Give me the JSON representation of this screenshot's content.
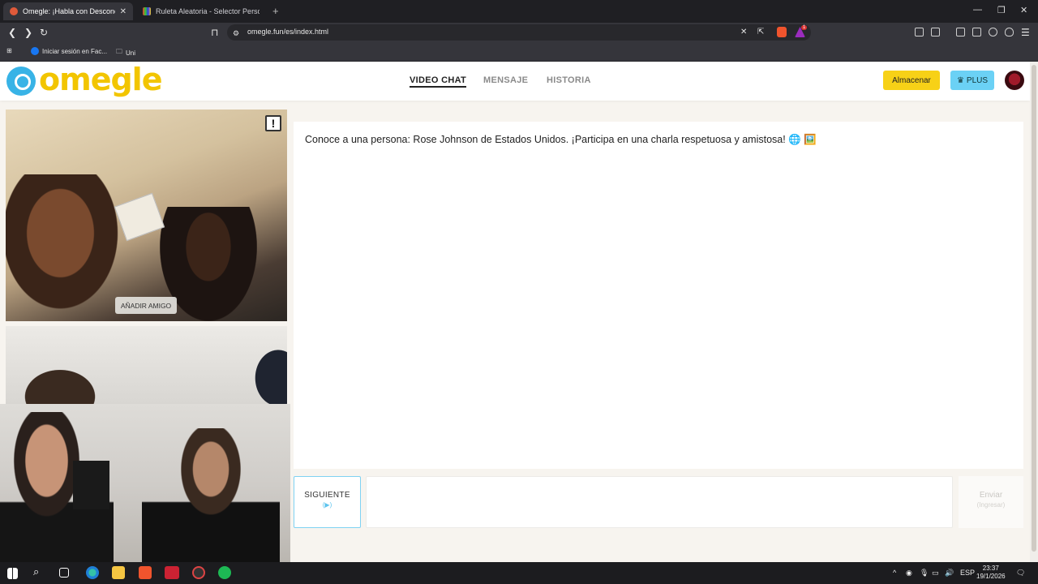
{
  "browser": {
    "tabs": [
      {
        "title": "Omegle: ¡Habla con Desconocidos",
        "active": true
      },
      {
        "title": "Ruleta Aleatoria - Selector Personalizado",
        "active": false
      }
    ],
    "url": "omegle.fun/es/index.html",
    "bookmarks": [
      "Iniciar sesión en Fac...",
      "Uni"
    ],
    "extension_badge": "1"
  },
  "site": {
    "logo": "omegle",
    "nav": [
      "VIDEO CHAT",
      "MENSAJE",
      "HISTORIA"
    ],
    "active_nav": "VIDEO CHAT",
    "store_button": "Almacenar",
    "plus_button": "PLUS",
    "plus_icon": "crown-icon"
  },
  "video": {
    "report_label": "!",
    "add_friend_label": "AÑADIR AMIGO"
  },
  "chat": {
    "message": "Conoce a una persona: Rose Johnson de Estados Unidos. ¡Participa en una charla respetuosa y amistosa! 🌐 🖼️"
  },
  "controls": {
    "next_label": "SIGUIENTE",
    "next_key": "(▶)",
    "send_label": "Enviar",
    "send_key": "(Ingresar)"
  },
  "taskbar": {
    "language": "ESP",
    "time": "23:37",
    "date": "19/1/2026"
  },
  "colors": {
    "brand_yellow": "#f2c500",
    "brand_blue": "#38b3e6",
    "store_yellow": "#f7d117",
    "plus_blue": "#6bd1f5"
  }
}
